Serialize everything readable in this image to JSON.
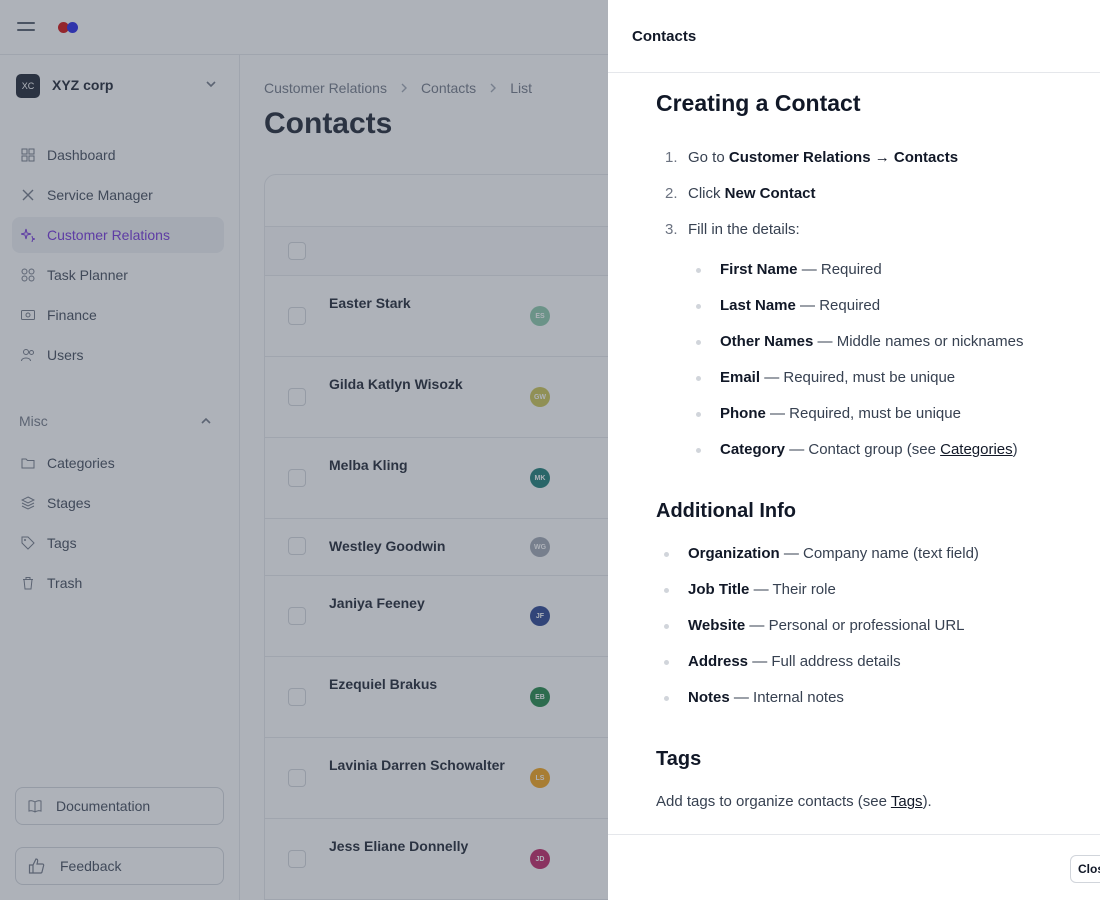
{
  "org": {
    "initials": "XC",
    "name": "XYZ corp"
  },
  "nav": [
    {
      "label": "Dashboard",
      "icon": "dashboard-icon"
    },
    {
      "label": "Service Manager",
      "icon": "tools-icon"
    },
    {
      "label": "Customer Relations",
      "icon": "sparkles-icon",
      "active": true
    },
    {
      "label": "Task Planner",
      "icon": "grid-icon"
    },
    {
      "label": "Finance",
      "icon": "money-icon"
    },
    {
      "label": "Users",
      "icon": "users-icon"
    }
  ],
  "misc": {
    "heading": "Misc",
    "items": [
      {
        "label": "Categories",
        "icon": "folder-icon"
      },
      {
        "label": "Stages",
        "icon": "layers-icon"
      },
      {
        "label": "Tags",
        "icon": "tag-icon"
      },
      {
        "label": "Trash",
        "icon": "trash-icon"
      }
    ]
  },
  "sidebar_footer": {
    "documentation": "Documentation",
    "feedback": "Feedback"
  },
  "breadcrumb": [
    "Customer Relations",
    "Contacts",
    "List"
  ],
  "page_title": "Contacts",
  "contacts": [
    {
      "name": "Easter Stark",
      "initials": "ES",
      "color": "#86c7a6"
    },
    {
      "name": "Gilda Katlyn Wisozk",
      "initials": "GW",
      "color": "#c9c24a"
    },
    {
      "name": "Melba Kling",
      "initials": "MK",
      "color": "#0f766e"
    },
    {
      "name": "Westley Goodwin",
      "initials": "WG",
      "color": "#9ca3af"
    },
    {
      "name": "Janiya Feeney",
      "initials": "JF",
      "color": "#1e3a8a"
    },
    {
      "name": "Ezequiel Brakus",
      "initials": "EB",
      "color": "#15803d"
    },
    {
      "name": "Lavinia Darren Schowalter",
      "initials": "LS",
      "color": "#f59e0b"
    },
    {
      "name": "Jess Eliane Donnelly",
      "initials": "JD",
      "color": "#be185d"
    }
  ],
  "panel": {
    "title": "Contacts",
    "close_label": "Close",
    "heading": "Creating a Contact",
    "steps": [
      {
        "num": "1.",
        "prefix": "Go to ",
        "bold": "Customer Relations → Contacts"
      },
      {
        "num": "2.",
        "prefix": "Click ",
        "bold": "New Contact"
      },
      {
        "num": "3.",
        "prefix": "Fill in the details:",
        "bold": ""
      }
    ],
    "fields": [
      {
        "name": "First Name",
        "desc": " — Required"
      },
      {
        "name": "Last Name",
        "desc": " — Required"
      },
      {
        "name": "Other Names",
        "desc": " — Middle names or nicknames"
      },
      {
        "name": "Email",
        "desc": " — Required, must be unique"
      },
      {
        "name": "Phone",
        "desc": " — Required, must be unique"
      },
      {
        "name": "Category",
        "desc": " — Contact group (see ",
        "link": "Categories",
        "tail": ")"
      }
    ],
    "additional_heading": "Additional Info",
    "additional": [
      {
        "name": "Organization",
        "desc": " — Company name (text field)"
      },
      {
        "name": "Job Title",
        "desc": " — Their role"
      },
      {
        "name": "Website",
        "desc": " — Personal or professional URL"
      },
      {
        "name": "Address",
        "desc": " — Full address details"
      },
      {
        "name": "Notes",
        "desc": " — Internal notes"
      }
    ],
    "tags_heading": "Tags",
    "tags_text": {
      "prefix": "Add tags to organize contacts (see ",
      "link": "Tags",
      "tail": ")."
    }
  },
  "colors": {
    "accent": "#6d28d9",
    "overlay": "rgba(75,85,99,0.45)"
  }
}
